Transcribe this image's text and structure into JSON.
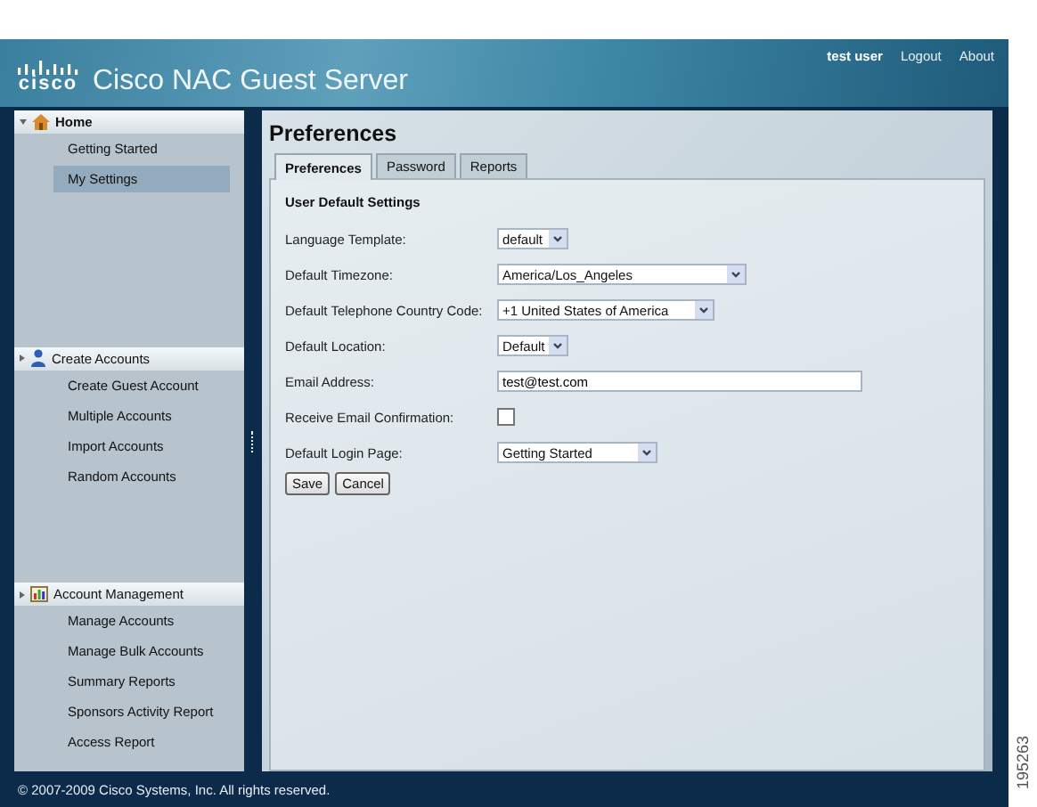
{
  "header": {
    "logo": "cisco",
    "product": "Cisco NAC Guest Server",
    "user": "test user",
    "links": [
      "Logout",
      "About"
    ]
  },
  "sidebar": {
    "sections": [
      {
        "title": "Home",
        "kind": "house",
        "expanded": true,
        "items": [
          {
            "label": "Getting Started",
            "selected": false
          },
          {
            "label": "My Settings",
            "selected": true
          }
        ]
      },
      {
        "title": "Create Accounts",
        "kind": "person",
        "expanded": false,
        "items": [
          {
            "label": "Create Guest Account",
            "selected": false
          },
          {
            "label": "Multiple Accounts",
            "selected": false
          },
          {
            "label": "Import Accounts",
            "selected": false
          },
          {
            "label": "Random Accounts",
            "selected": false
          }
        ]
      },
      {
        "title": "Account Management",
        "kind": "chart",
        "expanded": false,
        "items": [
          {
            "label": "Manage Accounts",
            "selected": false
          },
          {
            "label": "Manage Bulk Accounts",
            "selected": false
          },
          {
            "label": "Summary Reports",
            "selected": false
          },
          {
            "label": "Sponsors Activity Report",
            "selected": false
          },
          {
            "label": "Access Report",
            "selected": false
          }
        ]
      }
    ]
  },
  "page_title": "Preferences",
  "tabs": [
    {
      "label": "Preferences",
      "selected": true
    },
    {
      "label": "Password",
      "selected": false
    },
    {
      "label": "Reports",
      "selected": false
    }
  ],
  "form": {
    "heading": "User Default Settings",
    "fields": [
      {
        "label": "Language Template:",
        "kind": "select",
        "value": "default"
      },
      {
        "label": "Default Timezone:",
        "kind": "select",
        "value": "America/Los_Angeles"
      },
      {
        "label": "Default Telephone Country Code:",
        "kind": "select",
        "value": "+1 United States of America"
      },
      {
        "label": "Default Location:",
        "kind": "select",
        "value": "Default"
      },
      {
        "label": "Email Address:",
        "kind": "text",
        "value": "test@test.com"
      },
      {
        "label": "Receive Email Confirmation:",
        "kind": "checkbox",
        "checked": false
      },
      {
        "label": "Default Login Page:",
        "kind": "select",
        "value": "Getting Started"
      }
    ],
    "buttons": [
      "Save",
      "Cancel"
    ]
  },
  "footer": "© 2007-2009 Cisco Systems, Inc. All rights reserved.",
  "figure_number": "195263"
}
